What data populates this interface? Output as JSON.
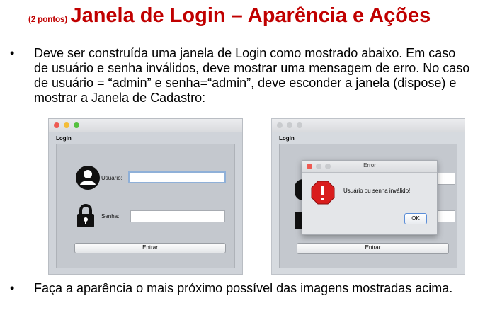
{
  "heading": {
    "prefix": "(2 pontos)",
    "title": "Janela de Login – Aparência e Ações"
  },
  "bullets": [
    "Deve ser construída uma janela de Login como mostrado abaixo. Em caso de usuário e senha inválidos, deve mostrar uma mensagem de erro. No caso de usuário = “admin” e senha=“admin”, deve esconder a janela (dispose) e mostrar a Janela de Cadastro:",
    "Faça a aparência o mais próximo possível das imagens mostradas acima."
  ],
  "bullet_symbol": "•",
  "login_window": {
    "title": "Login",
    "user_label": "Usuario:",
    "user_value": "",
    "password_label": "Senha:",
    "password_value": "",
    "submit_label": "Entrar",
    "icons": [
      "user-avatar-icon",
      "padlock-icon"
    ],
    "traffic_light_colors": [
      "#ee5a52",
      "#f4bd39",
      "#55c03f"
    ]
  },
  "error_dialog": {
    "title": "Error",
    "message": "Usuário ou senha inválido!",
    "ok_label": "OK",
    "icon": "error-octagon-icon",
    "icon_color": "#d91d1d"
  }
}
